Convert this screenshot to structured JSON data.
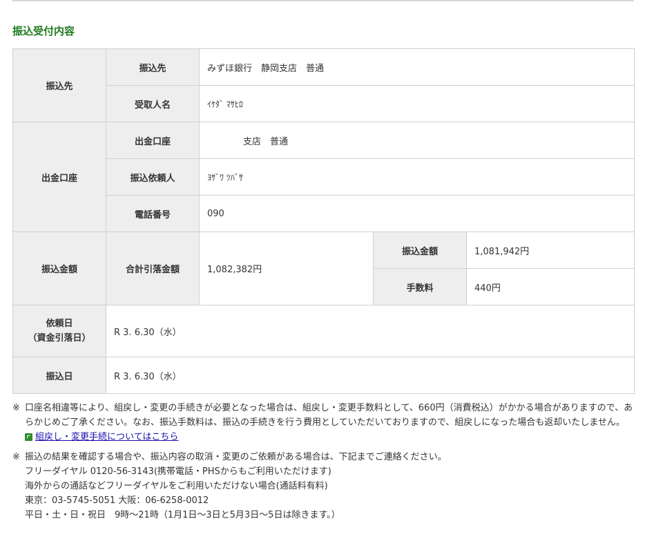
{
  "section_title": "振込受付内容",
  "transfer": {
    "payee_group": "振込先",
    "payee_label": "振込先",
    "payee_value": "みずほ銀行　静岡支店　普通",
    "recipient_label": "受取人名",
    "recipient_value": "ｲｹﾀﾞ ﾏｻﾋﾛ"
  },
  "source": {
    "group": "出金口座",
    "account_label": "出金口座",
    "account_value": "　　　　支店　普通",
    "requester_label": "振込依頼人",
    "requester_value": "ﾖｻﾞﾜ ﾂﾊﾞｻ",
    "phone_label": "電話番号",
    "phone_value": "090"
  },
  "amount": {
    "group": "振込金額",
    "total_label": "合計引落金額",
    "total_value": "1,082,382円",
    "transfer_label": "振込金額",
    "transfer_value": "1,081,942円",
    "fee_label": "手数料",
    "fee_value": "440円"
  },
  "request_date": {
    "label_line1": "依頼日",
    "label_line2": "（資金引落日）",
    "value": "R 3. 6.30（水）"
  },
  "transfer_date": {
    "label": "振込日",
    "value": "R 3. 6.30（水）"
  },
  "notes": {
    "mark": "※",
    "note1_text": "口座名相違等により、組戻し・変更の手続きが必要となった場合は、組戻し・変更手数料として、660円（消費税込）がかかる場合がありますので、あらかじめご了承ください。なお、振込手数料は、振込の手続きを行う費用としていただいておりますので、組戻しになった場合も返却いたしません。",
    "note1_link": "組戻し・変更手続についてはこちら",
    "note2_lines": [
      "振込の結果を確認する場合や、振込内容の取消・変更のご依頼がある場合は、下記までご連絡ください。",
      "フリーダイヤル 0120-56-3143(携帯電話・PHSからもご利用いただけます)",
      "海外からの通話などフリーダイヤルをご利用いただけない場合(通話料有料)",
      "東京：03-5745-5051 大阪：06-6258-0012",
      "平日・土・日・祝日　9時～21時（1月1日～3日と5月3日～5日は除きます。）"
    ]
  }
}
